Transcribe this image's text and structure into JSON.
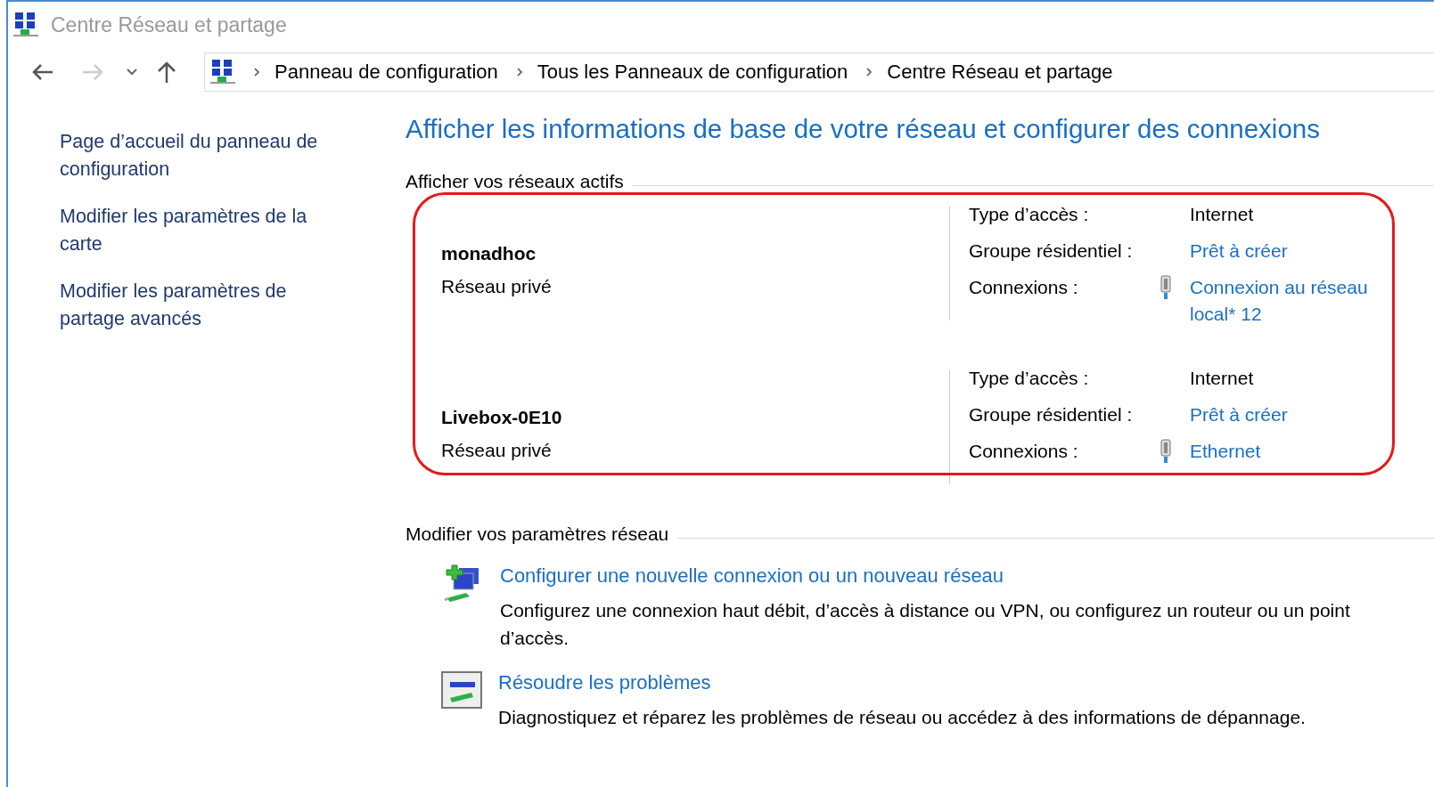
{
  "window": {
    "title": "Centre Réseau et partage"
  },
  "breadcrumb": [
    "Panneau de configuration",
    "Tous les Panneaux de configuration",
    "Centre Réseau et partage"
  ],
  "sidebar": {
    "links": [
      "Page d’accueil du panneau de configuration",
      "Modifier les paramètres de la carte",
      "Modifier les paramètres de partage avancés"
    ]
  },
  "heading": "Afficher les informations de base de votre réseau et configurer des connexions",
  "active_networks": {
    "title": "Afficher vos réseaux actifs",
    "networks": [
      {
        "name": "monadhoc",
        "category": "Réseau privé",
        "access_label": "Type d’accès :",
        "access_value": "Internet",
        "homegroup_label": "Groupe résidentiel :",
        "homegroup_value": "Prêt à créer",
        "connections_label": "Connexions :",
        "connection": "Connexion au réseau local* 12"
      },
      {
        "name": "Livebox-0E10",
        "category": "Réseau privé",
        "access_label": "Type d’accès :",
        "access_value": "Internet",
        "homegroup_label": "Groupe résidentiel :",
        "homegroup_value": "Prêt à créer",
        "connections_label": "Connexions :",
        "connection": "Ethernet"
      }
    ]
  },
  "settings": {
    "title": "Modifier vos paramètres réseau",
    "tasks": [
      {
        "kind": "new-connection",
        "link": "Configurer une nouvelle connexion ou un nouveau réseau",
        "description": "Configurez une connexion haut débit, d’accès à distance ou VPN, ou configurez un routeur ou un point d’accès."
      },
      {
        "kind": "troubleshoot",
        "link": "Résoudre les problèmes",
        "description": "Diagnostiquez et réparez les problèmes de réseau ou accédez à des informations de dépannage."
      }
    ]
  }
}
